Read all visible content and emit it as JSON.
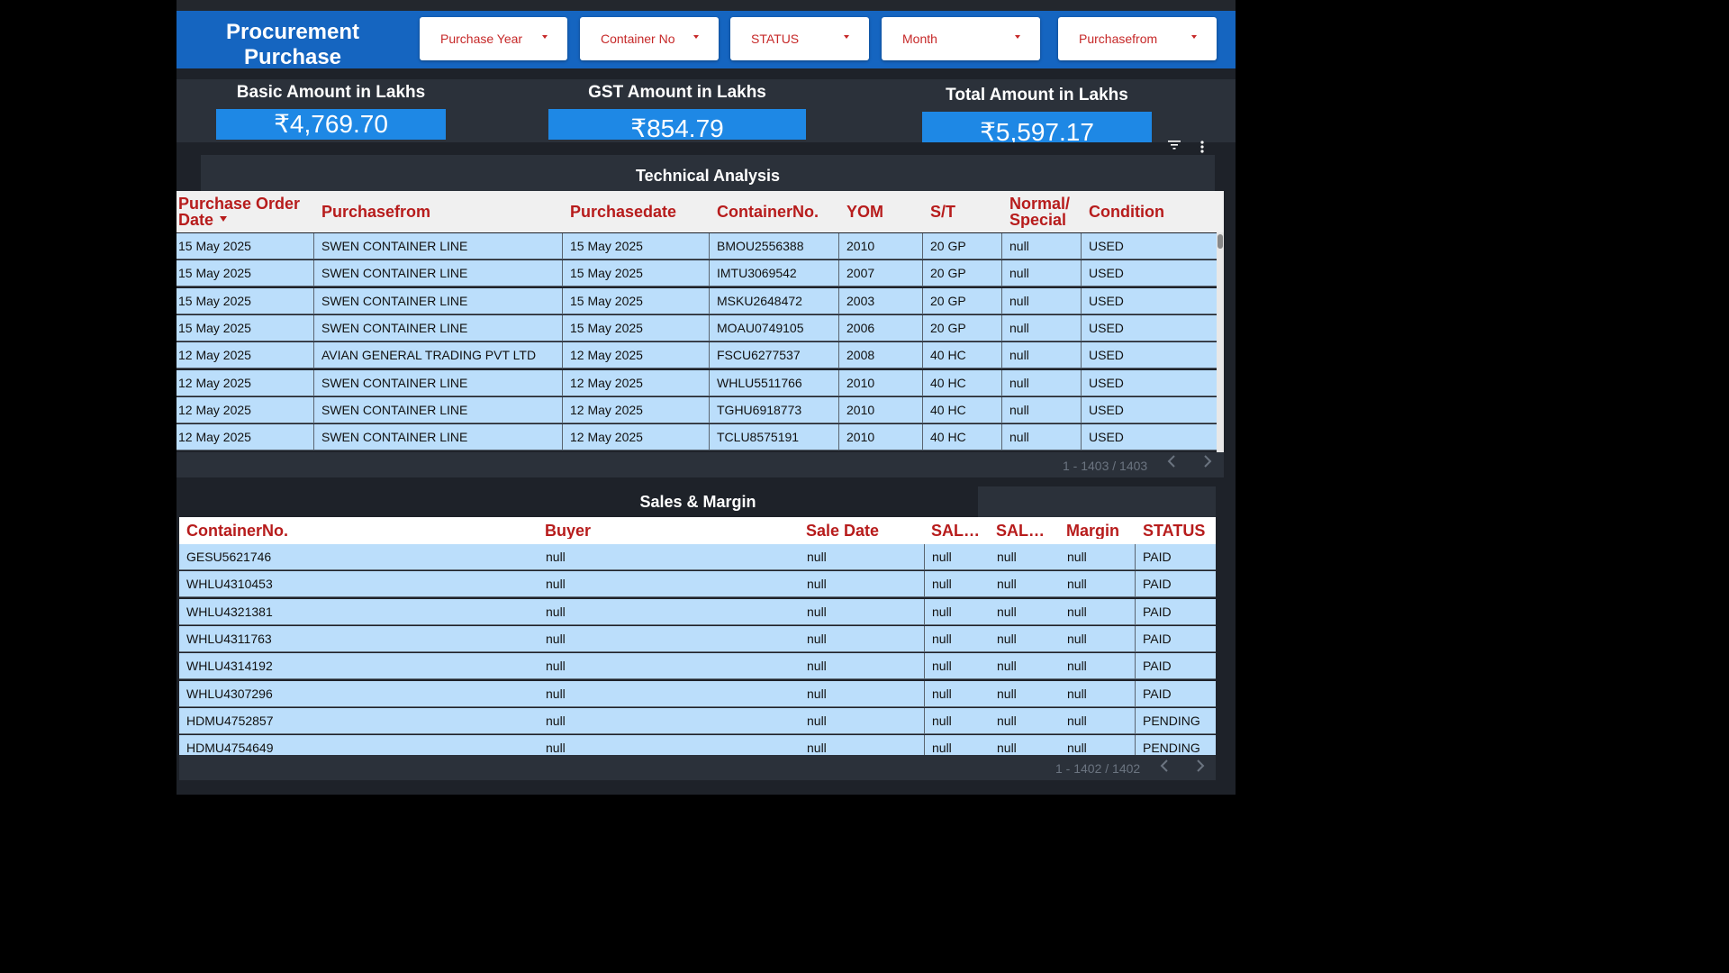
{
  "header": {
    "title_line1": "Procurement",
    "title_line2": "Purchase",
    "filters": [
      "Purchase Year",
      "Container No",
      "STATUS",
      "Month",
      "Purchasefrom"
    ]
  },
  "kpis": [
    {
      "label": "Basic Amount in Lakhs",
      "value": "₹4,769.70"
    },
    {
      "label": "GST Amount in Lakhs",
      "value": "₹854.79"
    },
    {
      "label": "Total Amount in Lakhs",
      "value": "₹5,597.17"
    }
  ],
  "technical": {
    "title": "Technical Analysis",
    "columns": [
      "Purchase Order Date",
      "Purchasefrom",
      "Purchasedate",
      "ContainerNo.",
      "YOM",
      "S/T",
      "Normal/ Special",
      "Condition"
    ],
    "rows": [
      [
        "15 May 2025",
        "SWEN CONTAINER LINE",
        "15 May 2025",
        "BMOU2556388",
        "2010",
        "20 GP",
        "null",
        "USED"
      ],
      [
        "15 May 2025",
        "SWEN CONTAINER LINE",
        "15 May 2025",
        "IMTU3069542",
        "2007",
        "20 GP",
        "null",
        "USED"
      ],
      [
        "15 May 2025",
        "SWEN CONTAINER LINE",
        "15 May 2025",
        "MSKU2648472",
        "2003",
        "20 GP",
        "null",
        "USED"
      ],
      [
        "15 May 2025",
        "SWEN CONTAINER LINE",
        "15 May 2025",
        "MOAU0749105",
        "2006",
        "20 GP",
        "null",
        "USED"
      ],
      [
        "12 May 2025",
        "AVIAN GENERAL TRADING PVT LTD",
        "12 May 2025",
        "FSCU6277537",
        "2008",
        "40 HC",
        "null",
        "USED"
      ],
      [
        "12 May 2025",
        "SWEN CONTAINER LINE",
        "12 May 2025",
        "WHLU5511766",
        "2010",
        "40 HC",
        "null",
        "USED"
      ],
      [
        "12 May 2025",
        "SWEN CONTAINER LINE",
        "12 May 2025",
        "TGHU6918773",
        "2010",
        "40 HC",
        "null",
        "USED"
      ],
      [
        "12 May 2025",
        "SWEN CONTAINER LINE",
        "12 May 2025",
        "TCLU8575191",
        "2010",
        "40 HC",
        "null",
        "USED"
      ]
    ],
    "pagination": "1 - 1403 / 1403"
  },
  "sales": {
    "title": "Sales & Margin",
    "columns": [
      "ContainerNo.",
      "Buyer",
      "Sale Date",
      "SAL…",
      "SAL…",
      "Margin",
      "STATUS"
    ],
    "rows": [
      [
        "GESU5621746",
        "null",
        "null",
        "null",
        "null",
        "null",
        "PAID"
      ],
      [
        "WHLU4310453",
        "null",
        "null",
        "null",
        "null",
        "null",
        "PAID"
      ],
      [
        "WHLU4321381",
        "null",
        "null",
        "null",
        "null",
        "null",
        "PAID"
      ],
      [
        "WHLU4311763",
        "null",
        "null",
        "null",
        "null",
        "null",
        "PAID"
      ],
      [
        "WHLU4314192",
        "null",
        "null",
        "null",
        "null",
        "null",
        "PAID"
      ],
      [
        "WHLU4307296",
        "null",
        "null",
        "null",
        "null",
        "null",
        "PAID"
      ],
      [
        "HDMU4752857",
        "null",
        "null",
        "null",
        "null",
        "null",
        "PENDING"
      ],
      [
        "HDMU4754649",
        "null",
        "null",
        "null",
        "null",
        "null",
        "PENDING"
      ]
    ],
    "pagination": "1 - 1402 / 1402"
  },
  "colors": {
    "header_bg": "#1565c0",
    "kpi_box": "#1e88e5",
    "column_header_text": "#b71c1c",
    "row_bg": "#bbdefb",
    "panel_bg": "#2b313a"
  },
  "icons": [
    "filter-icon",
    "more-vert-icon",
    "sort-desc-icon",
    "chevron-left-icon",
    "chevron-right-icon",
    "dropdown-caret-icon"
  ]
}
